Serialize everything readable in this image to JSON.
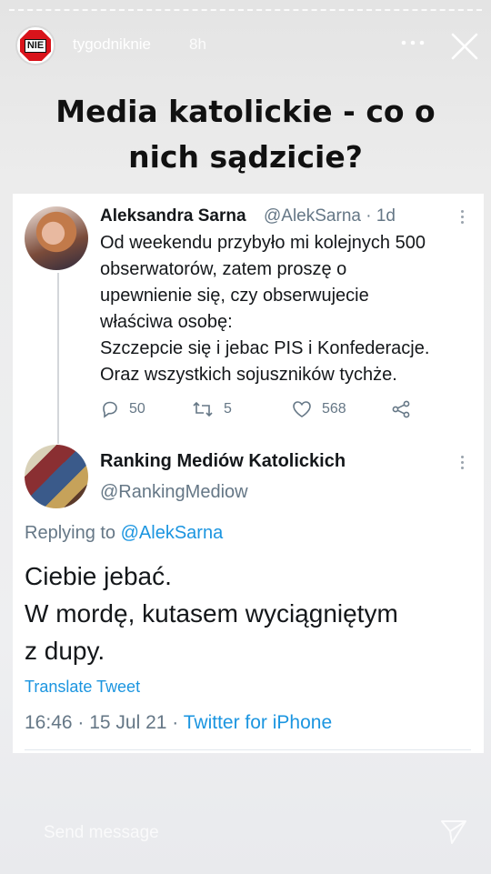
{
  "story": {
    "account": {
      "username": "tygodniknie",
      "time": "8h",
      "avatar_text": "NIE"
    },
    "headline": "Media katolickie - co o nich sądzicie?",
    "more_icon": "more-horizontal-icon",
    "close_icon": "close-icon",
    "reply_placeholder": "Send message",
    "send_icon": "send-icon"
  },
  "tweet": {
    "author_name": "Aleksandra Sarna",
    "author_handle": "@AlekSarna · 1d",
    "text": "Od weekendu przybyło mi kolejnych 500\nobserwatorów, zatem proszę o\nupewnienie się, czy obserwujecie\nwłaściwa osobę:\nSzczepcie się i jebac PIS i Konfederacje.\nOraz wszystkich sojuszników tychże.",
    "replies": "50",
    "retweets": "5",
    "likes": "568"
  },
  "reply": {
    "author_name": "Ranking Mediów Katolickich",
    "author_handle": "@RankingMediow",
    "replying_prefix": "Replying to ",
    "replying_to": "@AlekSarna",
    "text": "Ciebie jebać.\nW mordę,  kutasem wyciągniętym\nz dupy.",
    "translate_label": "Translate Tweet",
    "timestamp": "16:46 · 15 Jul 21 · ",
    "source": "Twitter for iPhone"
  },
  "colors": {
    "link": "#1b95e0",
    "muted": "#657786",
    "text": "#14171a",
    "brand_red": "#d9141b"
  }
}
